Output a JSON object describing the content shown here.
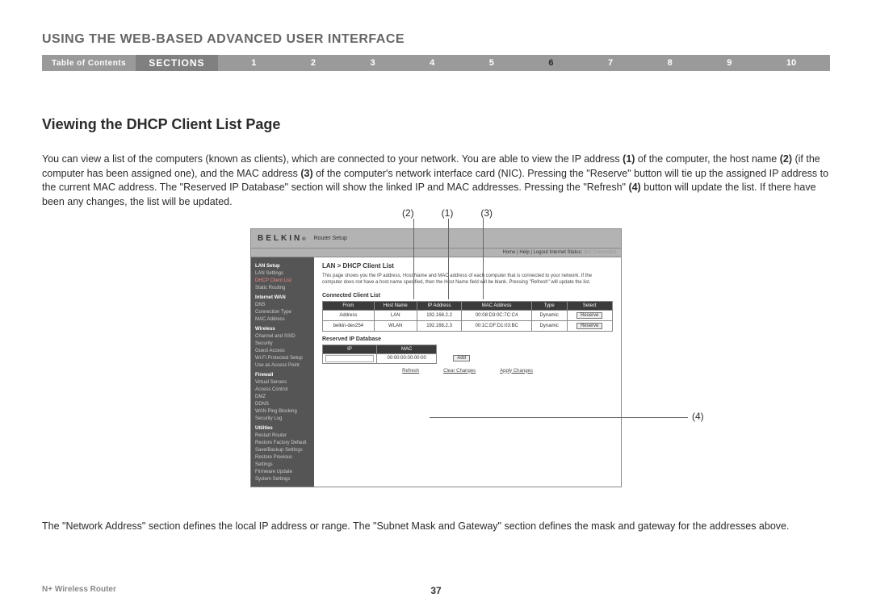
{
  "header": {
    "title": "USING THE WEB-BASED ADVANCED USER INTERFACE",
    "toc": "Table of Contents",
    "sections_label": "SECTIONS",
    "numbers": [
      "1",
      "2",
      "3",
      "4",
      "5",
      "6",
      "7",
      "8",
      "9",
      "10"
    ],
    "active": "6"
  },
  "section": {
    "heading": "Viewing the DHCP Client List Page",
    "para1_a": "You can view a list of the computers (known as clients), which are connected to your network. You are able to view the IP address ",
    "para1_b": " of the computer, the host name ",
    "para1_c": " (if the computer has been assigned one), and the MAC address ",
    "para1_d": " of the computer's network interface card (NIC). Pressing the \"Reserve\" button will tie up the assigned IP address to the current MAC address. The \"Reserved IP Database\" section will show the linked IP and MAC addresses. Pressing the \"Refresh\" ",
    "para1_e": " button will update the list. If there have been any changes, the list will be updated.",
    "n1": "(1)",
    "n2": "(2)",
    "n3": "(3)",
    "n4": "(4)",
    "para2": "The \"Network Address\" section defines the local IP address or range. The \"Subnet Mask and Gateway\" section defines the mask and gateway for the addresses above."
  },
  "callouts": {
    "c1": "(1)",
    "c2": "(2)",
    "c3": "(3)",
    "c4": "(4)"
  },
  "router": {
    "brand": "BELKIN",
    "brand_sep": "®",
    "setup": "Router Setup",
    "status_links": "Home | Help | Logout    Internet Status:",
    "status_value": "Not Connected",
    "sidebar": {
      "g1": "LAN Setup",
      "g1_items": [
        "LAN Settings",
        "DHCP Client List",
        "Static Routing"
      ],
      "g2": "Internet WAN",
      "g2_items": [
        "DNS",
        "Connection Type",
        "MAC Address"
      ],
      "g3": "Wireless",
      "g3_items": [
        "Channel and SSID",
        "Security",
        "Guest Access",
        "Wi-Fi Protected Setup",
        "Use as Access Point"
      ],
      "g4": "Firewall",
      "g4_items": [
        "Virtual Servers",
        "Access Control",
        "DMZ",
        "DDNS",
        "WAN Ping Blocking",
        "Security Log"
      ],
      "g5": "Utilities",
      "g5_items": [
        "Restart Router",
        "Restore Factory Default",
        "Save/Backup Settings",
        "Restore Previous Settings",
        "Firmware Update",
        "System Settings"
      ]
    },
    "main": {
      "title": "LAN > DHCP Client List",
      "desc": "This page shows you the IP address, Host Name and MAC address of each computer that is connected to your network. If the computer does not have a host name specified, then the Host Name field will be blank. Pressing \"Refresh\" will update the list.",
      "connected_label": "Connected Client List",
      "headers": [
        "From",
        "Host Name",
        "IP Address",
        "MAC Address",
        "Type",
        "Select"
      ],
      "rows": [
        {
          "from": "Address",
          "host": "LAN",
          "ip": "192.168.2.2",
          "mac": "00:08:D3:0C:7C:C4",
          "type": "Dynamic",
          "select": "Reserve"
        },
        {
          "from": "belkin-dev254",
          "host": "WLAN",
          "ip": "192.168.2.3",
          "mac": "00:1C:DF:D1:03:BC",
          "type": "Dynamic",
          "select": "Reserve"
        }
      ],
      "reserved_label": "Reserved IP Database",
      "reserved_headers": [
        "IP",
        "MAC"
      ],
      "reserved_mac": "00:00:00:00:00:00",
      "add": "Add",
      "refresh": "Refresh",
      "clear": "Clear Changes",
      "apply": "Apply Changes"
    }
  },
  "footer": {
    "product": "N+ Wireless Router",
    "page": "37"
  }
}
